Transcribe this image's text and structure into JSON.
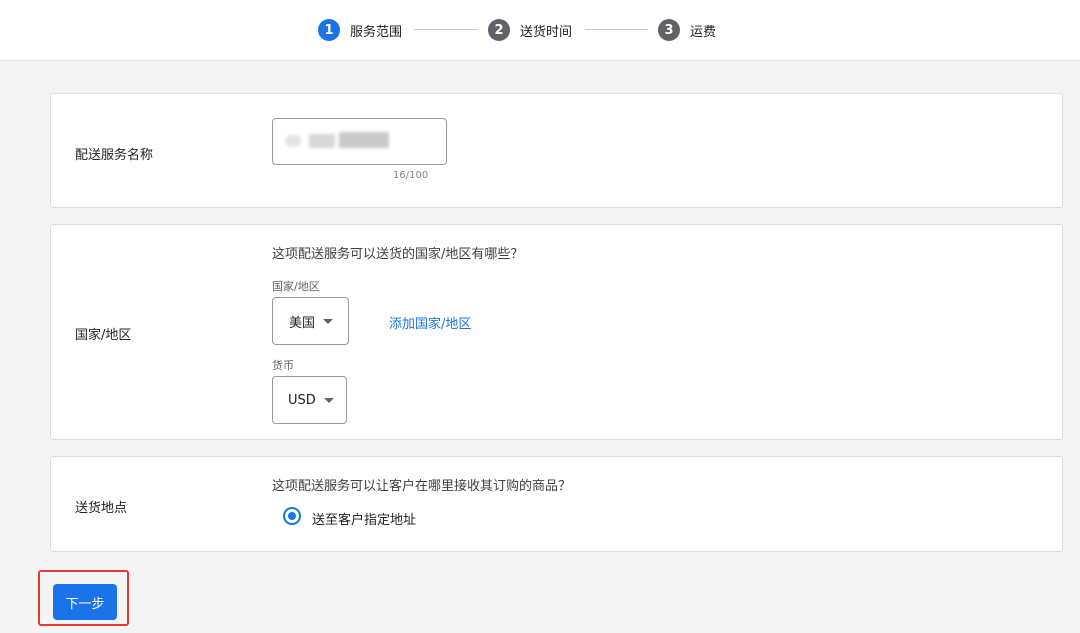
{
  "stepper": {
    "steps": [
      {
        "number": "1",
        "label": "服务范围"
      },
      {
        "number": "2",
        "label": "送货时间"
      },
      {
        "number": "3",
        "label": "运费"
      }
    ],
    "colors": {
      "active": "#1a73e8",
      "inactive": "#5f6368"
    }
  },
  "service_name": {
    "label": "配送服务名称",
    "char_count": "16/100"
  },
  "region": {
    "label": "国家/地区",
    "question": "这项配送服务可以送货的国家/地区有哪些？",
    "country_caption": "国家/地区",
    "country_value": "美国",
    "add_link": "添加国家/地区",
    "currency_caption": "货币",
    "currency_value": "USD"
  },
  "delivery": {
    "label": "送货地点",
    "question": "这项配送服务可以让客户在哪里接收其订购的商品？",
    "option_label": "送至客户指定地址"
  },
  "actions": {
    "next_label": "下一步"
  },
  "colors": {
    "primary": "#1a73e8",
    "highlight": "#e53935",
    "background": "#f4f4f4"
  }
}
